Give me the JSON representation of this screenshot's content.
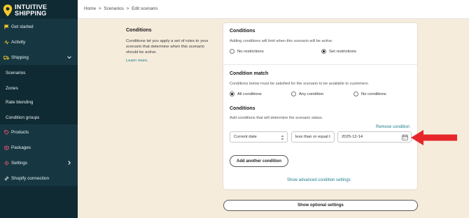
{
  "app": {
    "brand_line1": "INTUITIVE",
    "brand_line2": "SHIPPING"
  },
  "sidebar": {
    "items": [
      {
        "label": "Get started",
        "icon": "flag-icon"
      },
      {
        "label": "Activity",
        "icon": "activity-icon"
      },
      {
        "label": "Shipping",
        "icon": "truck-icon"
      },
      {
        "label": "Scenarios"
      },
      {
        "label": "Zones"
      },
      {
        "label": "Rate blending"
      },
      {
        "label": "Condition groups"
      },
      {
        "label": "Products",
        "icon": "tag-icon"
      },
      {
        "label": "Packages",
        "icon": "package-icon"
      },
      {
        "label": "Settings",
        "icon": "gear-icon"
      },
      {
        "label": "Shopify connection",
        "icon": "link-icon"
      }
    ]
  },
  "breadcrumb": {
    "home": "Home",
    "sep1": ">",
    "scenarios": "Scenarios",
    "sep2": ">",
    "current": "Edit scenario"
  },
  "section": {
    "title": "Conditions",
    "description": "Conditions let you apply a set of rules to your scenario that determine when this scenario should be active.",
    "learn_more": "Learn more."
  },
  "card": {
    "conditions_title": "Conditions",
    "conditions_desc": "Adding conditions will limit when this scenario will be active.",
    "no_restrictions": "No restrictions",
    "set_restrictions": "Set restrictions",
    "match_title": "Condition match",
    "match_desc": "Conditions below must be satisfied for the scenario to be available to customers.",
    "all_conditions": "All conditions",
    "any_condition": "Any condition",
    "no_conditions": "No conditions",
    "list_title": "Conditions",
    "list_desc": "Add conditions that will determine the scenario status.",
    "remove_condition": "Remove condition",
    "field_value": "Current date",
    "operator_value": "less than or equal t",
    "date_value": "2025-12-14",
    "add_another": "Add another condition",
    "advanced_link": "Show advanced condition settings"
  },
  "footer": {
    "optional_settings": "Show optional settings"
  },
  "colors": {
    "sidebar_bg": "#0f2a33",
    "accent_link": "#1d7d8a",
    "page_bg": "#f6ecdc",
    "arrow": "#e6262b",
    "logo_pin": "#f5c62a"
  }
}
